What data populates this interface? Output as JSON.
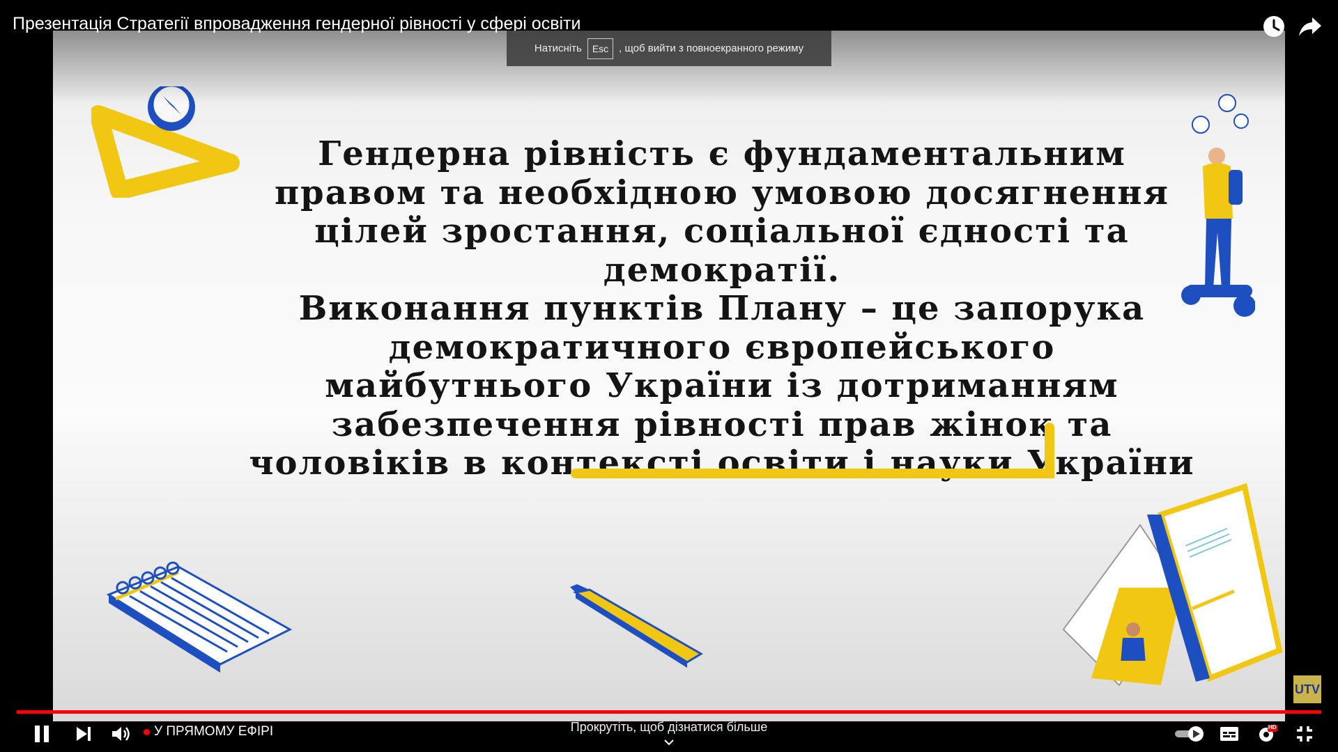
{
  "video": {
    "title": "Презентація Стратегії впровадження гендерної рівності у сфері освіти"
  },
  "fullscreen_toast": {
    "before": "Натисніть",
    "key": "Esc",
    "after": ", щоб вийти з повноекранного режиму"
  },
  "slide": {
    "text": "Гендерна рівність є фундаментальним\nправом та необхідною умовою досягнення\nцілей зростання, соціальної єдності та\nдемократії.\nВиконання пунктів  Плану – це запорука\nдемократичного європейського\nмайбутнього України із дотриманням\nзабезпечення рівності прав жінок та\nчоловіків в контексті освіти і науки України"
  },
  "player": {
    "live_label": "У ПРЯМОМУ ЕФІРІ",
    "scroll_hint": "Прокрутіть, щоб дізнатися більше",
    "hd_badge": "HD",
    "channel_badge": "UTV",
    "icons": [
      "pause-icon",
      "next-icon",
      "volume-icon",
      "autoplay-toggle-icon",
      "subtitles-icon",
      "settings-icon",
      "exit-fullscreen-icon",
      "watch-later-icon",
      "share-icon"
    ]
  },
  "colors": {
    "accent_yellow": "#f2c713",
    "accent_blue": "#1d4fc1",
    "progress_red": "#ff0000"
  }
}
